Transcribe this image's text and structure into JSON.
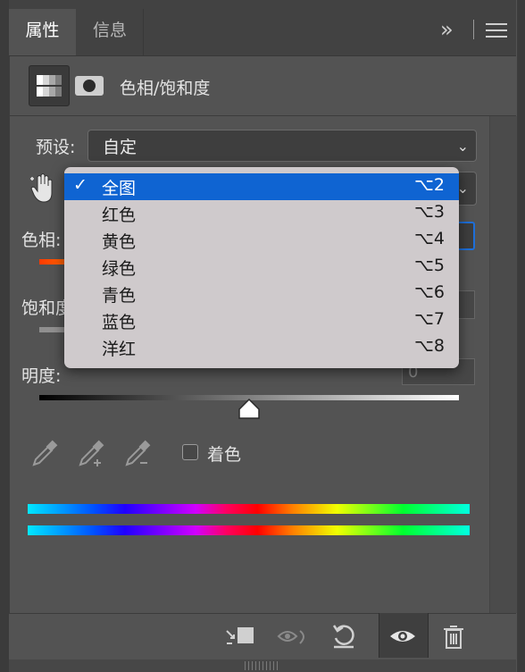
{
  "tabs": [
    {
      "label": "属性",
      "active": true
    },
    {
      "label": "信息",
      "active": false
    }
  ],
  "header": {
    "expand_glyph": "»",
    "menu_glyph": "≡",
    "adjustment_title": "色相/饱和度"
  },
  "preset": {
    "label": "预设:",
    "value": "自定"
  },
  "hue": {
    "label": "色相:"
  },
  "saturation": {
    "label": "饱和度"
  },
  "lightness": {
    "label": "明度:",
    "value": "0",
    "position": 0.5
  },
  "colorize": {
    "label": "着色",
    "checked": false
  },
  "channel_menu": {
    "items": [
      {
        "label": "全图",
        "shortcut": "⌥2",
        "selected": true
      },
      {
        "label": "红色",
        "shortcut": "⌥3",
        "selected": false
      },
      {
        "label": "黄色",
        "shortcut": "⌥4",
        "selected": false
      },
      {
        "label": "绿色",
        "shortcut": "⌥5",
        "selected": false
      },
      {
        "label": "青色",
        "shortcut": "⌥6",
        "selected": false
      },
      {
        "label": "蓝色",
        "shortcut": "⌥7",
        "selected": false
      },
      {
        "label": "洋红",
        "shortcut": "⌥8",
        "selected": false
      }
    ],
    "check_glyph": "✓"
  },
  "colors": {
    "panel_bg": "#535353",
    "menu_bg": "#cfcacc",
    "selection": "#0f64d2",
    "focus_ring": "#1e6fd9"
  },
  "footer_icons": [
    "clip-to-layer-icon",
    "view-previous-state-icon",
    "reset-icon",
    "visibility-eye-icon",
    "trash-icon"
  ]
}
